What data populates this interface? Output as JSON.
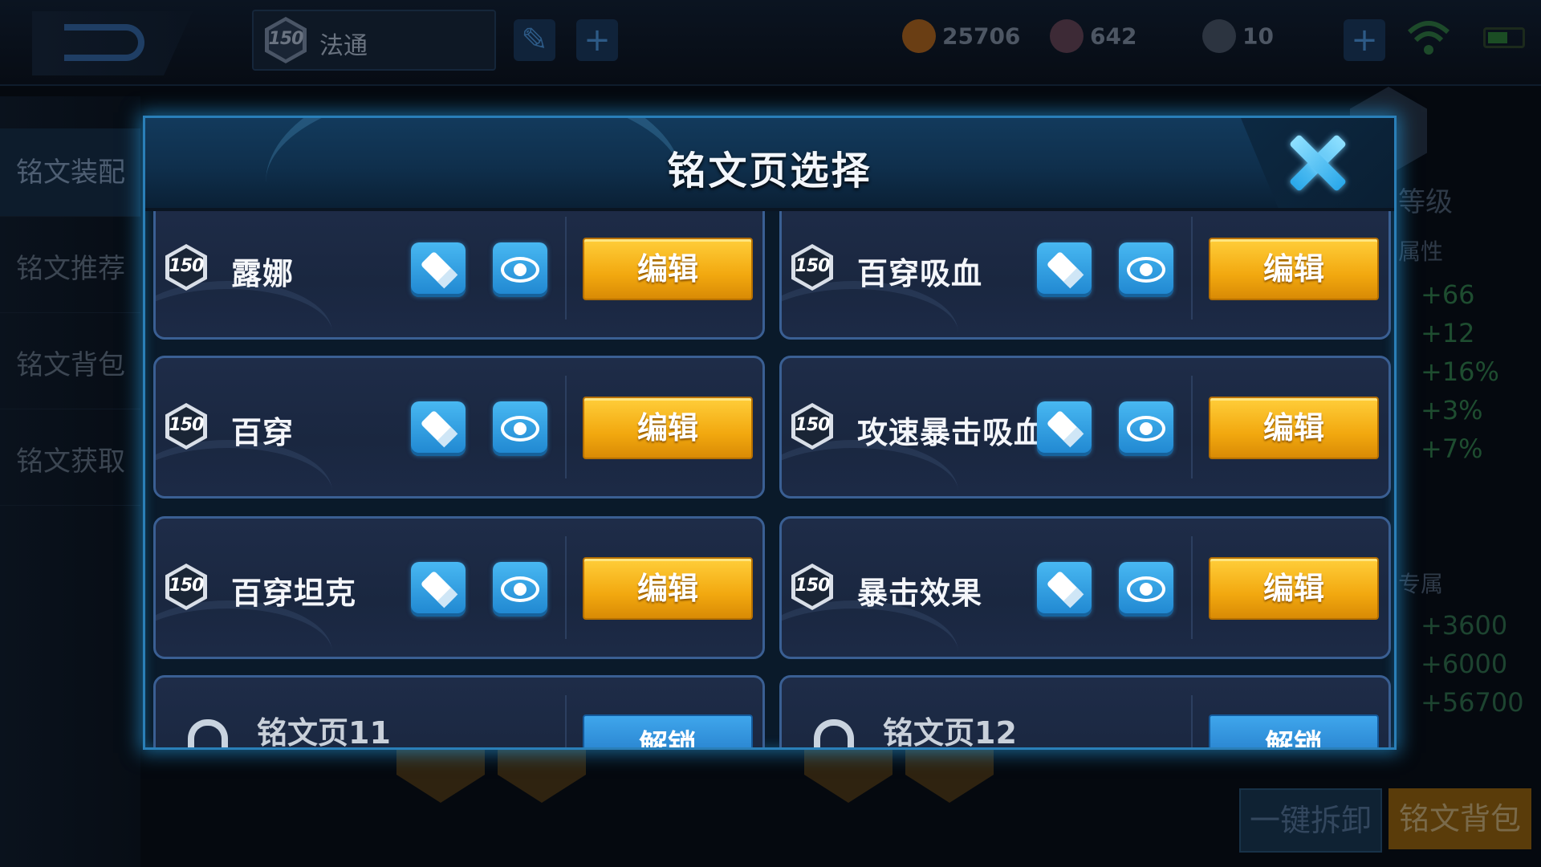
{
  "topbar": {
    "player_level": "150",
    "player_name": "法通",
    "gold": "25706",
    "diamonds": "642",
    "vouchers": "10"
  },
  "sidebar": {
    "items": [
      "铭文装配",
      "铭文推荐",
      "铭文背包",
      "铭文获取"
    ]
  },
  "right_panel": {
    "level_label": "等级",
    "attr_label": "属性",
    "stats": [
      "+66",
      "+12",
      "+16%",
      "+3%",
      "+7%"
    ],
    "exclusive_label": "专属",
    "exclusive_stats": [
      "+3600",
      "+6000",
      "+56700"
    ],
    "one_click_unequip": "一键拆卸",
    "inscription_bag": "铭文背包"
  },
  "modal": {
    "title": "铭文页选择",
    "edit_label": "编辑",
    "unlock_label": "解锁",
    "pages": [
      {
        "level": "150",
        "name": "露娜"
      },
      {
        "level": "150",
        "name": "百穿吸血"
      },
      {
        "level": "150",
        "name": "百穿"
      },
      {
        "level": "150",
        "name": "攻速暴击吸血"
      },
      {
        "level": "150",
        "name": "百穿坦克"
      },
      {
        "level": "150",
        "name": "暴击效果"
      }
    ],
    "locked_pages": [
      {
        "name": "铭文页11"
      },
      {
        "name": "铭文页12"
      }
    ]
  },
  "colors": {
    "accent_blue": "#2aa8ea",
    "edit_gold": "#f2a80f",
    "card_bg": "#1e2c48"
  }
}
